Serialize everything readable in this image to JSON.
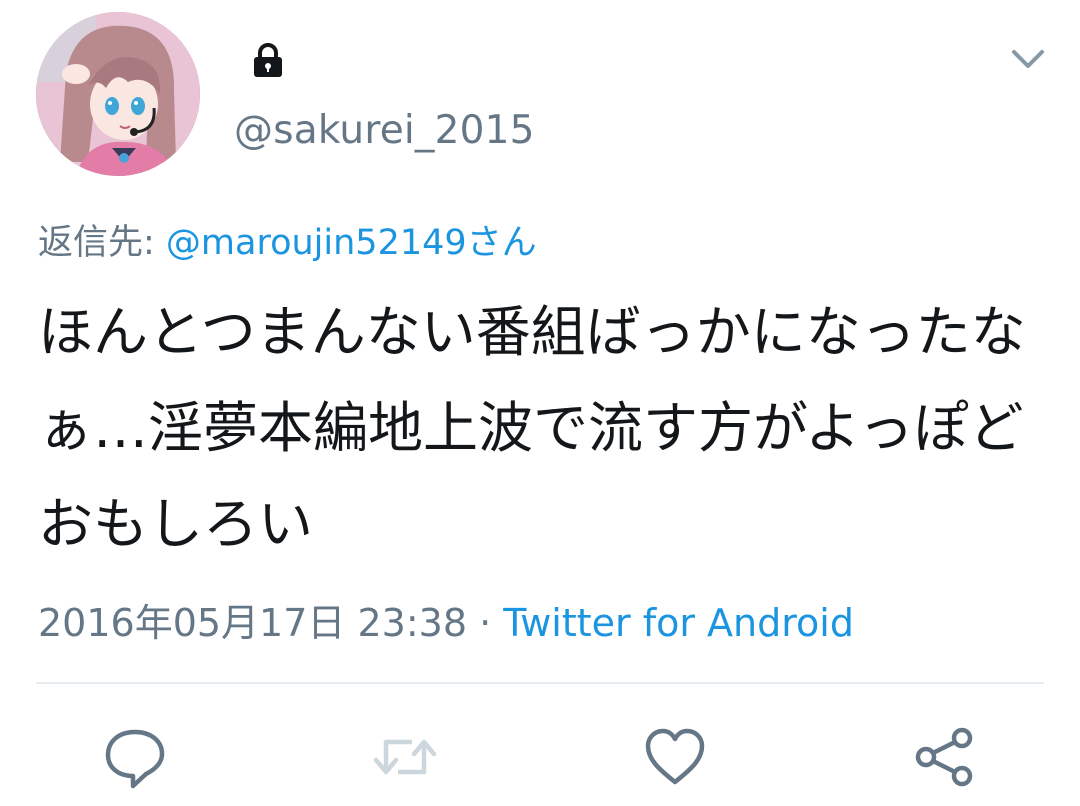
{
  "tweet": {
    "avatar_icon": "user-avatar-anime-girl",
    "lock_icon": "lock-icon",
    "handle": "@sakurei_2015",
    "menu_icon": "chevron-down-icon",
    "reply_prefix": "返信先: ",
    "reply_mention": "@maroujin52149さん",
    "text": "ほんとつまんない番組ばっかになったなぁ…淫夢本編地上波で流す方がよっぽどおもしろい",
    "timestamp": "2016年05月17日 23:38",
    "separator": " · ",
    "source": "Twitter for Android"
  },
  "actions": {
    "reply_icon": "reply-icon",
    "retweet_icon": "retweet-icon",
    "like_icon": "heart-icon",
    "share_icon": "share-icon"
  },
  "colors": {
    "text": "#14171a",
    "secondary": "#657786",
    "link": "#1b95e0",
    "divider": "#e6ecf0"
  }
}
